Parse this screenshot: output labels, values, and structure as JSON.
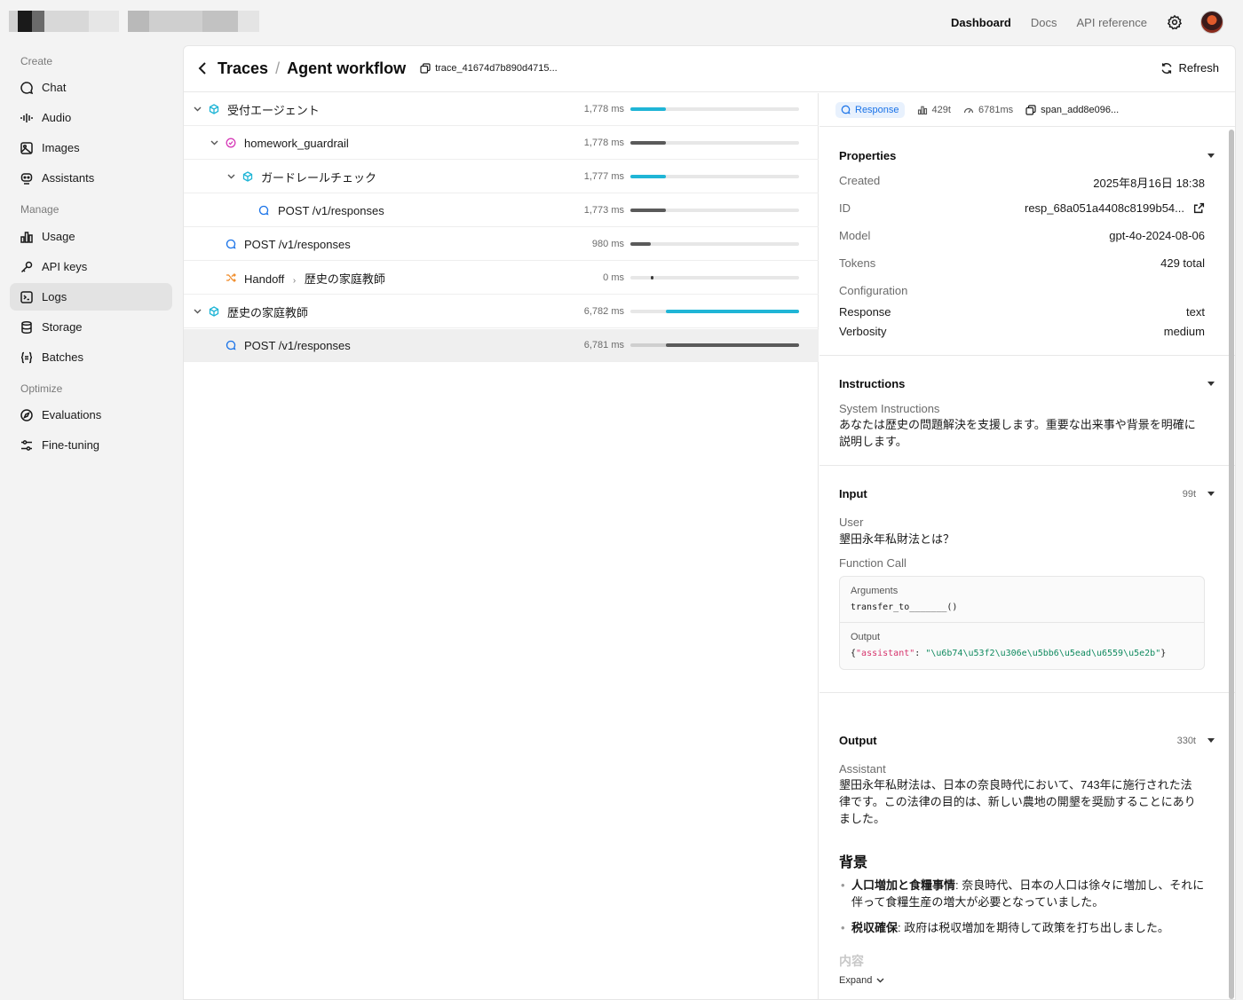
{
  "topnav": {
    "dashboard": "Dashboard",
    "docs": "Docs",
    "api_reference": "API reference"
  },
  "sidebar": {
    "sections": [
      "Create",
      "Manage",
      "Optimize"
    ],
    "items": [
      {
        "label": "Chat",
        "icon": "chat-bubble-icon"
      },
      {
        "label": "Audio",
        "icon": "waveform-icon"
      },
      {
        "label": "Images",
        "icon": "image-icon"
      },
      {
        "label": "Assistants",
        "icon": "robot-icon"
      },
      {
        "label": "Usage",
        "icon": "bar-chart-icon"
      },
      {
        "label": "API keys",
        "icon": "key-icon"
      },
      {
        "label": "Logs",
        "icon": "terminal-icon",
        "active": true
      },
      {
        "label": "Storage",
        "icon": "database-icon"
      },
      {
        "label": "Batches",
        "icon": "braces-icon"
      },
      {
        "label": "Evaluations",
        "icon": "compass-icon"
      },
      {
        "label": "Fine-tuning",
        "icon": "sliders-icon"
      }
    ]
  },
  "header": {
    "back_label": "Traces",
    "separator": "/",
    "title": "Agent workflow",
    "trace_id": "trace_41674d7b890d4715...",
    "refresh": "Refresh"
  },
  "tree": {
    "rows": [
      {
        "label": "受付エージェント",
        "duration": "1,778 ms",
        "type": "agent",
        "bar_start": 0.0,
        "bar_end": 0.21,
        "color": "#1fb5d6"
      },
      {
        "label": "homework_guardrail",
        "duration": "1,778 ms",
        "type": "guardrail",
        "bar_start": 0.0,
        "bar_end": 0.21,
        "color": "#5a5a5a"
      },
      {
        "label": "ガードレールチェック",
        "duration": "1,777 ms",
        "type": "agent",
        "bar_start": 0.0,
        "bar_end": 0.21,
        "color": "#1fb5d6"
      },
      {
        "label": "POST /v1/responses",
        "duration": "1,773 ms",
        "type": "response",
        "bar_start": 0.0,
        "bar_end": 0.21,
        "color": "#5a5a5a"
      },
      {
        "label": "POST /v1/responses",
        "duration": "980 ms",
        "type": "response",
        "bar_start": 0.0,
        "bar_end": 0.12,
        "color": "#5a5a5a"
      },
      {
        "label": "Handoff",
        "target": "歴史の家庭教師",
        "duration": "0 ms",
        "type": "handoff",
        "bar_start": 0.12,
        "bar_end": 0.135,
        "color": "#3a3a3a"
      },
      {
        "label": "歴史の家庭教師",
        "duration": "6,782 ms",
        "type": "agent",
        "bar_start": 0.21,
        "bar_end": 1.0,
        "color": "#1fb5d6"
      },
      {
        "label": "POST /v1/responses",
        "duration": "6,781 ms",
        "type": "response",
        "bar_start": 0.21,
        "bar_end": 1.0,
        "color": "#5a5a5a",
        "selected": true
      }
    ]
  },
  "detail": {
    "pill": "Response",
    "tokens": "429t",
    "time": "6781ms",
    "span_id": "span_add8e096...",
    "properties": {
      "title": "Properties",
      "created_label": "Created",
      "created": "2025年8月16日 18:38",
      "id_label": "ID",
      "id": "resp_68a051a4408c8199b54...",
      "model_label": "Model",
      "model": "gpt-4o-2024-08-06",
      "tokens_label": "Tokens",
      "tokens": "429 total",
      "config_label": "Configuration",
      "response_label": "Response",
      "response": "text",
      "verbosity_label": "Verbosity",
      "verbosity": "medium"
    },
    "instructions": {
      "title": "Instructions",
      "label": "System Instructions",
      "text": "あなたは歴史の問題解決を支援します。重要な出来事や背景を明確に説明します。"
    },
    "input": {
      "title": "Input",
      "count": "99t",
      "user_label": "User",
      "user_text": "墾田永年私財法とは？",
      "fc_label": "Function Call",
      "arguments_label": "Arguments",
      "arguments": "transfer_to_______()",
      "output_label": "Output",
      "output_brace_open": "{",
      "output_key": "\"assistant\"",
      "output_colon": ": ",
      "output_value": "\"\\u6b74\\u53f2\\u306e\\u5bb6\\u5ead\\u6559\\u5e2b\"",
      "output_brace_close": "}"
    },
    "output": {
      "title": "Output",
      "count": "330t",
      "label": "Assistant",
      "text": "墾田永年私財法は、日本の奈良時代において、743年に施行された法律です。この法律の目的は、新しい農地の開墾を奨励することにありました。",
      "heading": "背景",
      "bullet1_bold": "人口増加と食糧事情",
      "bullet1_text": ": 奈良時代、日本の人口は徐々に増加し、それに伴って食糧生産の増大が必要となっていました。",
      "bullet2_bold": "税収確保",
      "bullet2_text": ": 政府は税収増加を期待して政策を打ち出しました。",
      "faded": "内容",
      "expand": "Expand"
    }
  }
}
